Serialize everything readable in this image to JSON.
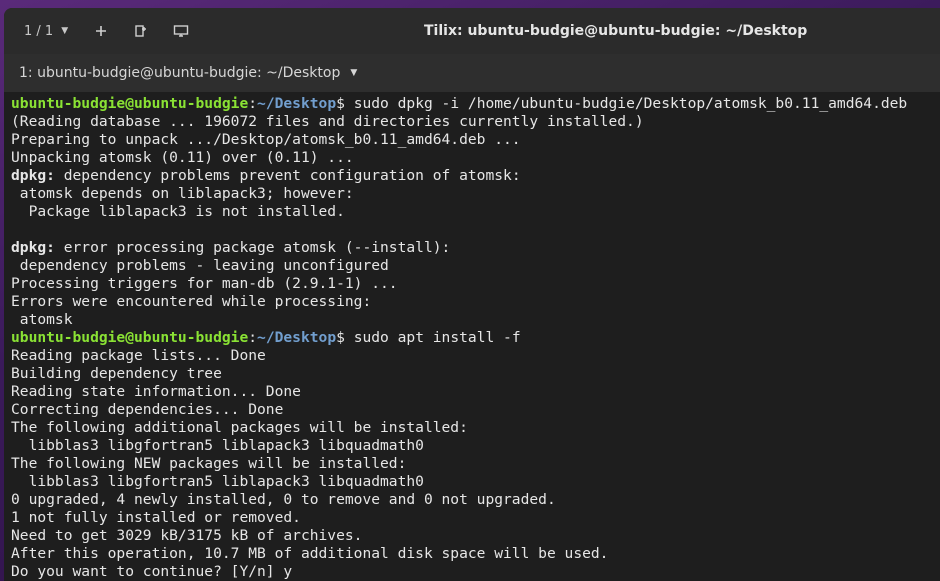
{
  "titlebar": {
    "session_indicator": "1 / 1",
    "add_icon": "plus-icon",
    "title": "Tilix: ubuntu-budgie@ubuntu-budgie: ~/Desktop"
  },
  "tab": {
    "label": "1: ubuntu-budgie@ubuntu-budgie: ~/Desktop"
  },
  "colors": {
    "prompt_user": "#8ae234",
    "prompt_path": "#729fcf",
    "terminal_bg": "#1e1e1e",
    "text": "#e6e6e6"
  },
  "terminal": {
    "prompt_user": "ubuntu-budgie@ubuntu-budgie",
    "prompt_colon": ":",
    "prompt_path": "~/Desktop",
    "prompt_dollar": "$",
    "cmd1": " sudo dpkg -i /home/ubuntu-budgie/Desktop/atomsk_b0.11_amd64.deb",
    "cmd2": " sudo apt install -f",
    "dpkg_label": "dpkg:",
    "lines_a": [
      "(Reading database ... 196072 files and directories currently installed.)",
      "Preparing to unpack .../Desktop/atomsk_b0.11_amd64.deb ...",
      "Unpacking atomsk (0.11) over (0.11) ..."
    ],
    "dpkg1_rest": " dependency problems prevent configuration of atomsk:",
    "lines_b": [
      " atomsk depends on liblapack3; however:",
      "  Package liblapack3 is not installed.",
      ""
    ],
    "dpkg2_rest": " error processing package atomsk (--install):",
    "lines_c": [
      " dependency problems - leaving unconfigured",
      "Processing triggers for man-db (2.9.1-1) ...",
      "Errors were encountered while processing:",
      " atomsk"
    ],
    "lines_d": [
      "Reading package lists... Done",
      "Building dependency tree",
      "Reading state information... Done",
      "Correcting dependencies... Done",
      "The following additional packages will be installed:",
      "  libblas3 libgfortran5 liblapack3 libquadmath0",
      "The following NEW packages will be installed:",
      "  libblas3 libgfortran5 liblapack3 libquadmath0",
      "0 upgraded, 4 newly installed, 0 to remove and 0 not upgraded.",
      "1 not fully installed or removed.",
      "Need to get 3029 kB/3175 kB of archives.",
      "After this operation, 10.7 MB of additional disk space will be used.",
      "Do you want to continue? [Y/n] y"
    ]
  }
}
